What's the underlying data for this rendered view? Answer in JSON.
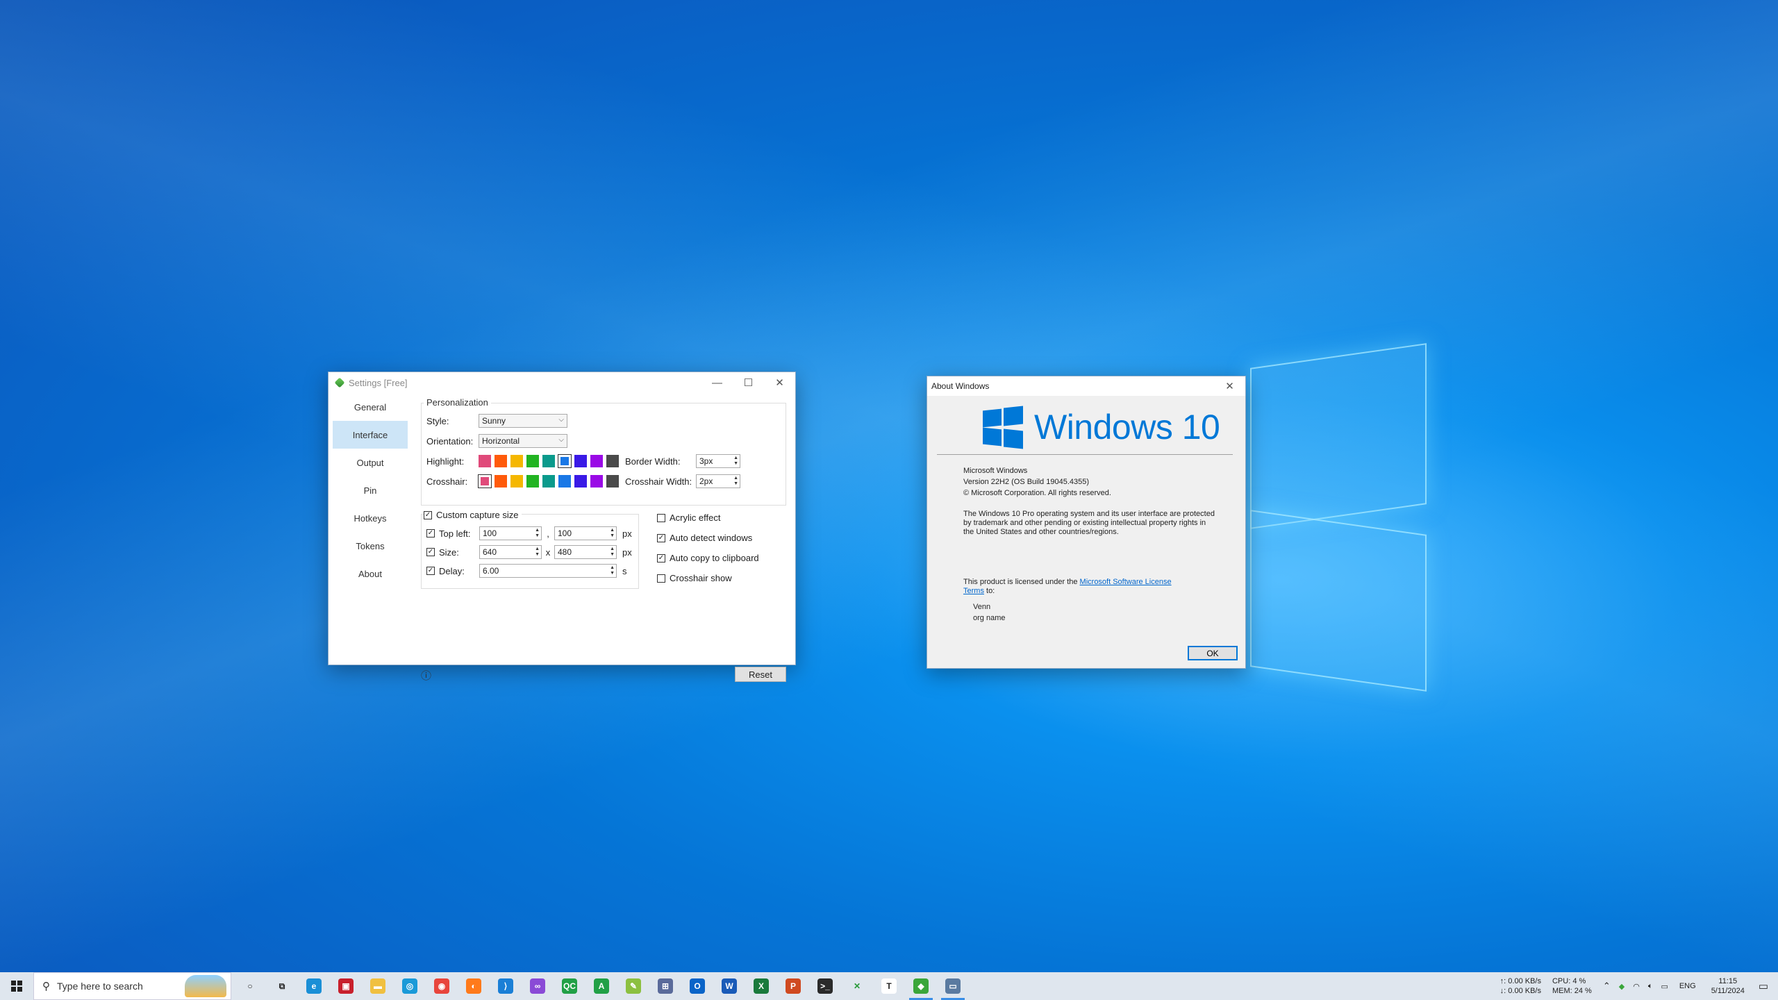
{
  "colors": {
    "accent": "#0078d7",
    "nav_active": "#cde5f7",
    "highlight_swatches": [
      "#e04a7a",
      "#ff5a0a",
      "#f5b700",
      "#22b422",
      "#0a9a8c",
      "#1a78e6",
      "#3a1ae6",
      "#9a0ae6",
      "#4a4a4a"
    ]
  },
  "settings": {
    "title": "Settings [Free]",
    "nav": [
      "General",
      "Interface",
      "Output",
      "Pin",
      "Hotkeys",
      "Tokens",
      "About"
    ],
    "active_nav": "Interface",
    "personalization": {
      "label": "Personalization",
      "style_label": "Style:",
      "style_value": "Sunny",
      "orientation_label": "Orientation:",
      "orientation_value": "Horizontal",
      "highlight_label": "Highlight:",
      "crosshair_label": "Crosshair:",
      "border_width_label": "Border Width:",
      "border_width_value": "3px",
      "crosshair_width_label": "Crosshair Width:",
      "crosshair_width_value": "2px"
    },
    "capture": {
      "custom_label": "Custom capture size",
      "top_left_label": "Top left:",
      "top_left_x": "100",
      "top_left_y": "100",
      "comma": ",",
      "size_label": "Size:",
      "size_w": "640",
      "size_h": "480",
      "x_sep": "x",
      "delay_label": "Delay:",
      "delay_value": "6.00",
      "px": "px",
      "s": "s"
    },
    "options": {
      "acrylic": "Acrylic effect",
      "auto_detect": "Auto detect windows",
      "auto_copy": "Auto copy to clipboard",
      "crosshair_show": "Crosshair show"
    },
    "reset_label": "Reset",
    "info_glyph": "ⓘ"
  },
  "about": {
    "title": "About Windows",
    "logo_text": "Windows 10",
    "line1": "Microsoft Windows",
    "line2": "Version 22H2 (OS Build 19045.4355)",
    "line3": "© Microsoft Corporation. All rights reserved.",
    "para1": "The Windows 10 Pro operating system and its user interface are protected",
    "para2": "by trademark and other pending or existing intellectual property rights in",
    "para3": "the United States and other countries/regions.",
    "license_pre": "This product is licensed under the ",
    "license_link1": "Microsoft Software License",
    "license_link2": "Terms",
    "license_post": " to:",
    "user": "Venn",
    "org": "org name",
    "ok_label": "OK"
  },
  "taskbar": {
    "search_placeholder": "Type here to search",
    "net_up": "↑: 0.00 KB/s",
    "net_down": "↓: 0.00 KB/s",
    "cpu": "CPU: 4 %",
    "mem": "MEM: 24 %",
    "lang": "ENG",
    "time": "11:15",
    "date": "5/11/2024",
    "apps": [
      {
        "name": "cortana-icon",
        "glyph": "○",
        "color": "transparent",
        "fg": "#222"
      },
      {
        "name": "task-view-icon",
        "glyph": "⧉",
        "color": "transparent",
        "fg": "#222"
      },
      {
        "name": "edge-icon",
        "glyph": "e",
        "color": "#1a8fd6",
        "fg": "#fff"
      },
      {
        "name": "pdf-reader-icon",
        "glyph": "▣",
        "color": "#c8202c",
        "fg": "#fff"
      },
      {
        "name": "file-explorer-icon",
        "glyph": "▬",
        "color": "#f0c040",
        "fg": "#fff"
      },
      {
        "name": "search-tool-icon",
        "glyph": "◎",
        "color": "#1a9ad8",
        "fg": "#fff"
      },
      {
        "name": "chrome-icon",
        "glyph": "◉",
        "color": "#e8453c",
        "fg": "#fff"
      },
      {
        "name": "firefox-icon",
        "glyph": "◐",
        "color": "#ff7a1a",
        "fg": "#fff"
      },
      {
        "name": "vscode-icon",
        "glyph": "⟩",
        "color": "#1a7fd6",
        "fg": "#fff"
      },
      {
        "name": "visual-studio-icon",
        "glyph": "∞",
        "color": "#8a4ad6",
        "fg": "#fff"
      },
      {
        "name": "qc-app-icon",
        "glyph": "QC",
        "color": "#21a046",
        "fg": "#fff"
      },
      {
        "name": "a-app-icon",
        "glyph": "A",
        "color": "#21a046",
        "fg": "#fff"
      },
      {
        "name": "notepadpp-icon",
        "glyph": "✎",
        "color": "#8cc040",
        "fg": "#fff"
      },
      {
        "name": "network-tool-icon",
        "glyph": "⊞",
        "color": "#5a6a9a",
        "fg": "#fff"
      },
      {
        "name": "outlook-icon",
        "glyph": "O",
        "color": "#0a64c8",
        "fg": "#fff"
      },
      {
        "name": "word-icon",
        "glyph": "W",
        "color": "#1a5bb8",
        "fg": "#fff"
      },
      {
        "name": "excel-icon",
        "glyph": "X",
        "color": "#1a7a3c",
        "fg": "#fff"
      },
      {
        "name": "powerpoint-icon",
        "glyph": "P",
        "color": "#d04a20",
        "fg": "#fff"
      },
      {
        "name": "terminal-icon",
        "glyph": ">_",
        "color": "#2a2a2a",
        "fg": "#fff"
      },
      {
        "name": "x-tool-icon",
        "glyph": "✕",
        "color": "transparent",
        "fg": "#2a9a3a"
      },
      {
        "name": "typora-icon",
        "glyph": "T",
        "color": "#ffffff",
        "fg": "#222"
      },
      {
        "name": "snip-app-icon",
        "glyph": "◆",
        "color": "#3aa63a",
        "fg": "#fff",
        "active": true
      },
      {
        "name": "about-windows-icon",
        "glyph": "▭",
        "color": "#5a7aa0",
        "fg": "#fff",
        "active": true
      }
    ]
  }
}
